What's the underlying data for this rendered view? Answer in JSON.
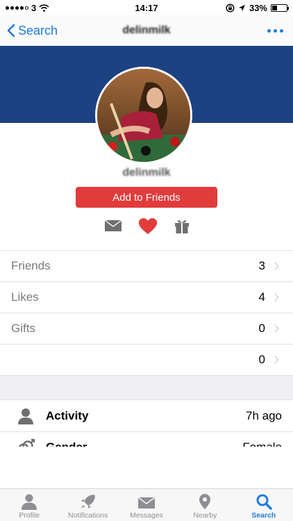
{
  "status_bar": {
    "carrier": "3",
    "time": "14:17",
    "battery": "33%",
    "battery_level": 0.33
  },
  "nav": {
    "back_label": "Search",
    "title": "delinmilk",
    "back_icon": "chevron-left-icon",
    "more_icon": "more-icon"
  },
  "profile": {
    "username": "delinmilk",
    "add_button_label": "Add to Friends",
    "actions": [
      "mail-icon",
      "heart-icon",
      "gift-icon"
    ],
    "banner_color": "#1c4281",
    "accent_color": "#e23b3b"
  },
  "stats": [
    {
      "label": "Friends",
      "value": "3"
    },
    {
      "label": "Likes",
      "value": "4"
    },
    {
      "label": "Gifts",
      "value": "0"
    },
    {
      "label": "",
      "value": "0"
    }
  ],
  "info": [
    {
      "icon": "person-icon",
      "label": "Activity",
      "value": "7h ago"
    },
    {
      "icon": "gender-icon",
      "label": "Gender",
      "value": "Female"
    }
  ],
  "tabs": [
    {
      "label": "Profile",
      "icon": "person-icon",
      "active": false
    },
    {
      "label": "Notifications",
      "icon": "rocket-icon",
      "active": false
    },
    {
      "label": "Messages",
      "icon": "envelope-icon",
      "active": false
    },
    {
      "label": "Nearby",
      "icon": "location-pin-icon",
      "active": false
    },
    {
      "label": "Search",
      "icon": "search-icon",
      "active": true
    }
  ]
}
